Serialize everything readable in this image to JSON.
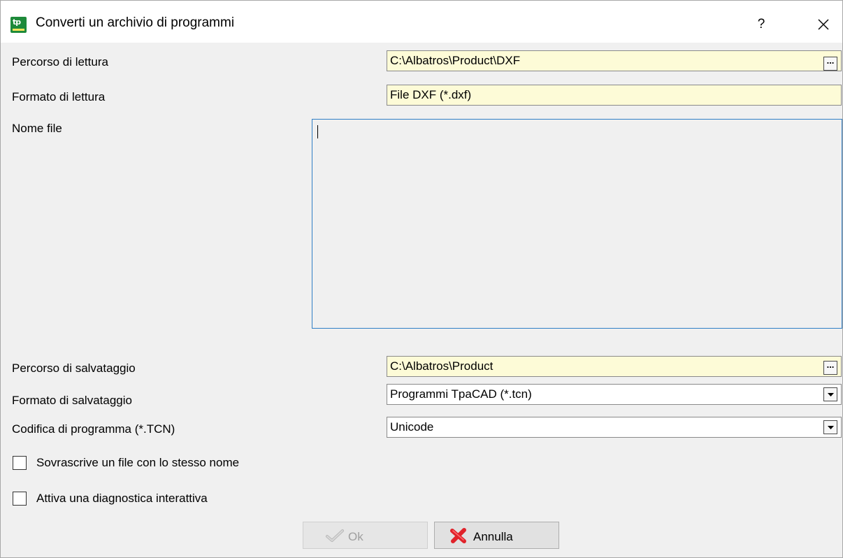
{
  "window": {
    "title": "Converti un archivio di programmi",
    "help_glyph": "?",
    "app_icon_glyph": "tp"
  },
  "form": {
    "read_path": {
      "label": "Percorso di lettura",
      "value": "C:\\Albatros\\Product\\DXF",
      "browse_glyph": "..."
    },
    "read_format": {
      "label": "Formato di lettura",
      "value": "File DXF (*.dxf)"
    },
    "file_name": {
      "label": "Nome file",
      "value": ""
    },
    "save_path": {
      "label": "Percorso di salvataggio",
      "value": "C:\\Albatros\\Product",
      "browse_glyph": "..."
    },
    "save_format": {
      "label": "Formato di salvataggio",
      "selected": "Programmi TpaCAD (*.tcn)"
    },
    "encoding": {
      "label": "Codifica di programma (*.TCN)",
      "selected": "Unicode"
    },
    "overwrite": {
      "label": "Sovrascrive un file con lo stesso nome",
      "checked": false
    },
    "diagnostics": {
      "label": "Attiva una diagnostica interattiva",
      "checked": false
    }
  },
  "buttons": {
    "ok": {
      "label": "Ok",
      "icon": "check-icon",
      "enabled": false
    },
    "cancel": {
      "label": "Annulla",
      "icon": "red-x-icon"
    }
  },
  "colors": {
    "field_yellow": "#fdfbd7",
    "focus_border": "#2f7fc6",
    "dialog_bg": "#f0f0f0",
    "cancel_icon_red": "#e0222a"
  }
}
